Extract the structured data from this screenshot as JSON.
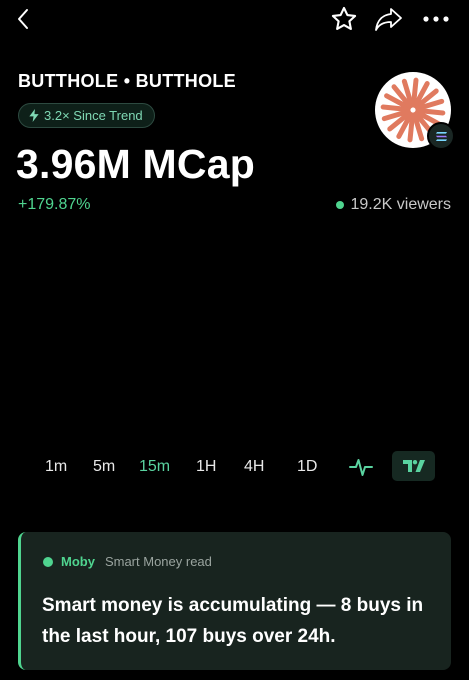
{
  "header": {
    "back_icon": "chevron-left-icon",
    "star_icon": "star-icon",
    "share_icon": "share-icon",
    "more_icon": "more-horizontal-icon"
  },
  "token": {
    "name": "BUTTHOLE • BUTTHOLE",
    "trend_badge": "3.2× Since Trend",
    "market_cap": "3.96M MCap",
    "change": "+179.87%",
    "viewers": "19.2K viewers"
  },
  "colors": {
    "accent_green": "#4fd48f",
    "avatar_rays": "#e07a5f",
    "card_bg": "#18241f"
  },
  "timeframes": {
    "items": [
      "1m",
      "5m",
      "15m",
      "1H",
      "4H",
      "1D"
    ],
    "selected": "15m",
    "line_chart_icon": "pulse-icon",
    "tradingview_icon": "tradingview-icon"
  },
  "insight": {
    "source": "Moby",
    "tag": "Smart Money read",
    "text": "Smart money is accumulating — 8 buys in the last hour, 107 buys over 24h."
  }
}
